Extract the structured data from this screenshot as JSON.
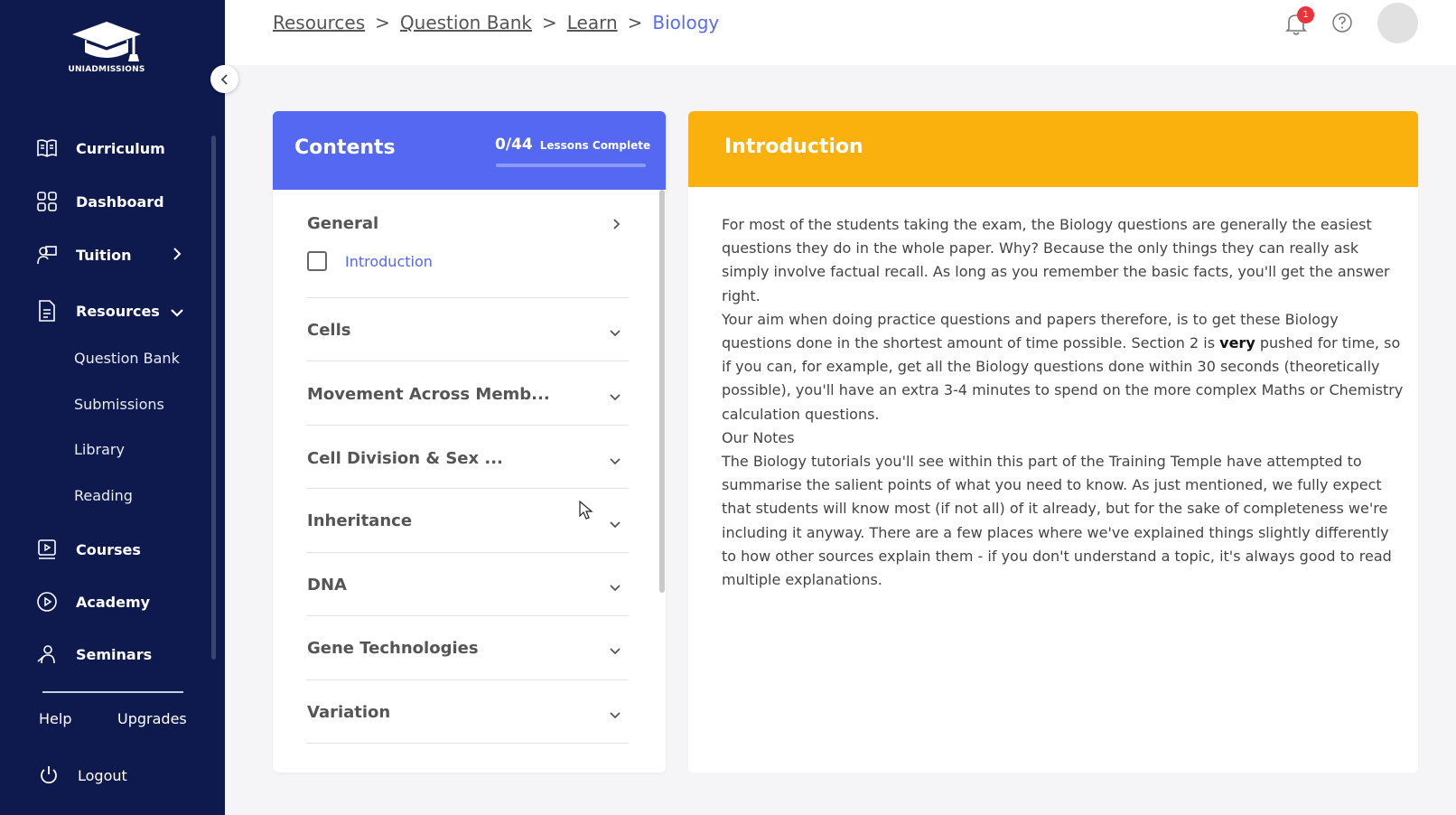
{
  "sidebar": {
    "logo_text": "UNIADMISSIONS",
    "nav": [
      {
        "label": "Curriculum",
        "icon": "book-icon"
      },
      {
        "label": "Dashboard",
        "icon": "grid-icon"
      },
      {
        "label": "Tuition",
        "icon": "teacher-icon"
      },
      {
        "label": "Resources",
        "icon": "document-icon"
      },
      {
        "label": "Courses",
        "icon": "video-icon"
      },
      {
        "label": "Academy",
        "icon": "play-circle-icon"
      },
      {
        "label": "Seminars",
        "icon": "presenter-icon"
      }
    ],
    "resources_sub": [
      "Question Bank",
      "Submissions",
      "Library",
      "Reading"
    ],
    "help": "Help",
    "upgrades": "Upgrades",
    "logout": "Logout"
  },
  "topbar": {
    "breadcrumbs": [
      "Resources",
      "Question Bank",
      "Learn"
    ],
    "current": "Biology",
    "separator": ">",
    "notification_count": "1"
  },
  "contents": {
    "title": "Contents",
    "progress_count": "0/44",
    "progress_label": "Lessons Complete",
    "progress_fraction": 0.0,
    "sections": [
      {
        "title": "General",
        "lessons": [
          "Introduction"
        ]
      },
      {
        "title": "Cells"
      },
      {
        "title": "Movement Across Memb..."
      },
      {
        "title": "Cell Division & Sex ..."
      },
      {
        "title": "Inheritance"
      },
      {
        "title": "DNA"
      },
      {
        "title": "Gene Technologies"
      },
      {
        "title": "Variation"
      }
    ]
  },
  "intro": {
    "title": "Introduction",
    "p1": "For most of the students taking the exam, the Biology questions are generally the easiest questions they do in the whole paper. Why? Because the only things they can really ask simply involve factual recall. As long as you remember the basic facts, you'll get the answer right.",
    "p2_before": "Your aim when doing practice questions and papers therefore, is to get these Biology questions done in the shortest amount of time possible. Section 2 is ",
    "p2_bold": "very",
    "p2_after": " pushed for time, so if you can, for example, get all the Biology questions done within 30 seconds (theoretically possible), you'll have an extra 3-4 minutes to spend on the more complex Maths or Chemistry calculation questions.",
    "p3": "Our Notes",
    "p4": "The Biology tutorials you'll see within this part of the Training Temple have attempted to summarise the salient points of what you need to know. As just mentioned, we fully expect that students will know most (if not all) of it already, but for the sake of completeness we're including it anyway. There are a few places where we've explained things slightly differently to how other sources explain them - if you don't understand a topic, it's always good to read multiple explanations."
  }
}
